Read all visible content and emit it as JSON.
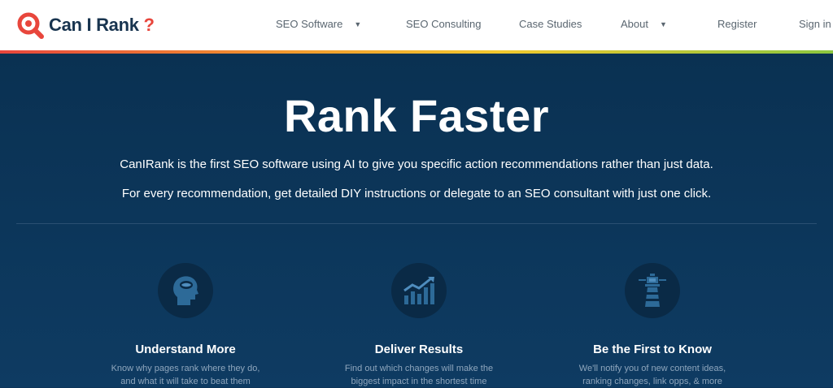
{
  "logo": {
    "text": "Can I Rank",
    "accent": "?"
  },
  "nav": {
    "items": [
      {
        "label": "SEO Software",
        "has_dropdown": true
      },
      {
        "label": "SEO Consulting",
        "has_dropdown": false
      },
      {
        "label": "Case Studies",
        "has_dropdown": false
      },
      {
        "label": "About",
        "has_dropdown": true
      },
      {
        "label": "Register",
        "has_dropdown": false
      },
      {
        "label": "Sign in",
        "has_dropdown": false
      }
    ],
    "dropdown_icon": "caret-down-icon"
  },
  "hero": {
    "title": "Rank Faster",
    "line1": "CanIRank is the first SEO software using AI to give you specific action recommendations rather than just data.",
    "line2": "For every recommendation, get detailed DIY instructions or delegate to an SEO consultant with just one click."
  },
  "features": [
    {
      "icon": "head-brain-icon",
      "title": "Understand More",
      "desc1": "Know why pages rank where they do,",
      "desc2": "and what it will take to beat them"
    },
    {
      "icon": "growth-chart-icon",
      "title": "Deliver Results",
      "desc1": "Find out which changes will make the",
      "desc2": "biggest impact in the shortest time"
    },
    {
      "icon": "lighthouse-icon",
      "title": "Be the First to Know",
      "desc1": "We'll notify you of new content ideas,",
      "desc2": "ranking changes, link opps, & more"
    }
  ],
  "colors": {
    "brand_red": "#e8463c",
    "brand_navy": "#18344f",
    "hero_bg": "#0d3559",
    "icon_circle": "#0a2a46",
    "icon_fg": "#2d6a98"
  }
}
